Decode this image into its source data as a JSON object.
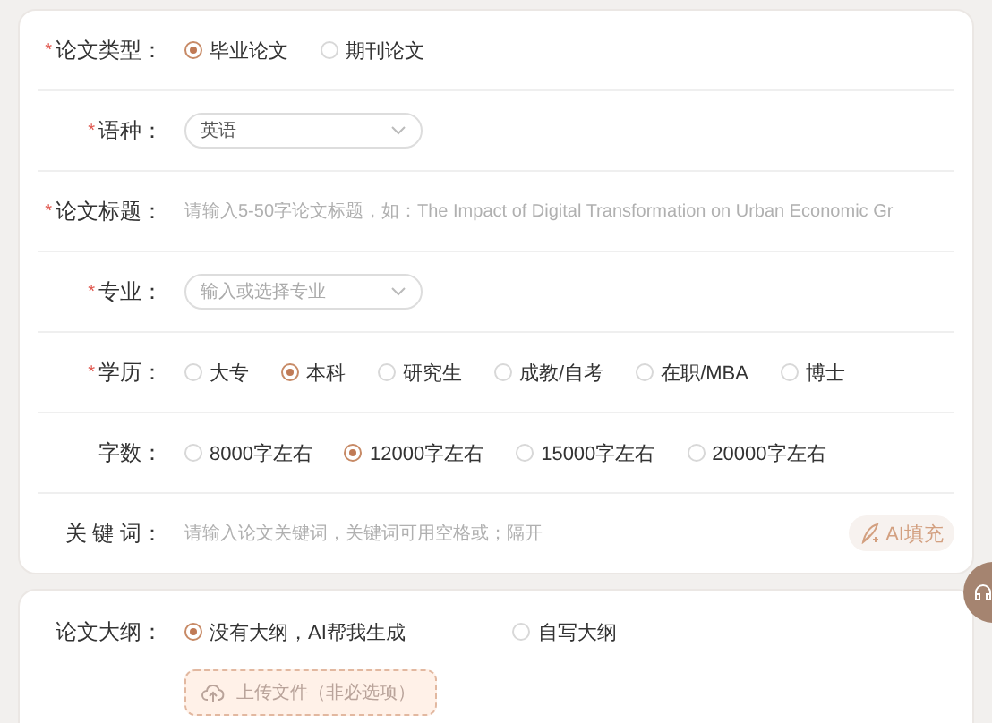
{
  "form": {
    "fields": [
      {
        "kind": "radio",
        "label": "论文类型：",
        "asterisk": "*",
        "options": [
          {
            "label": "毕业论文",
            "selected": true
          },
          {
            "label": "期刊论文",
            "selected": false
          }
        ]
      },
      {
        "kind": "select",
        "label": "语种：",
        "asterisk": "*",
        "value": "英语"
      },
      {
        "kind": "text",
        "label": "论文标题：",
        "asterisk": "*",
        "placeholder": "请输入5-50字论文标题，如：The Impact of Digital Transformation on Urban Economic Gr"
      },
      {
        "kind": "select",
        "label": "专业：",
        "asterisk": "*",
        "placeholder": "输入或选择专业"
      },
      {
        "kind": "radio",
        "label": "学历：",
        "asterisk": "*",
        "options": [
          {
            "label": "大专",
            "selected": false
          },
          {
            "label": "本科",
            "selected": true
          },
          {
            "label": "研究生",
            "selected": false
          },
          {
            "label": "成教/自考",
            "selected": false
          },
          {
            "label": "在职/MBA",
            "selected": false
          },
          {
            "label": "博士",
            "selected": false
          }
        ]
      },
      {
        "kind": "radio",
        "label": "字数：",
        "options": [
          {
            "label": "8000字左右",
            "selected": false
          },
          {
            "label": "12000字左右",
            "selected": true
          },
          {
            "label": "15000字左右",
            "selected": false
          },
          {
            "label": "20000字左右",
            "selected": false
          }
        ]
      },
      {
        "kind": "text",
        "label": "关 键 词：",
        "placeholder": "请输入论文关键词，关键词可用空格或；隔开",
        "action": "AI填充"
      }
    ]
  },
  "outline": {
    "label": "论文大纲：",
    "options": [
      {
        "label": "没有大纲，AI帮我生成",
        "selected": true
      },
      {
        "label": "自写大纲",
        "selected": false
      }
    ],
    "upload": "上传文件（非必选项）"
  }
}
